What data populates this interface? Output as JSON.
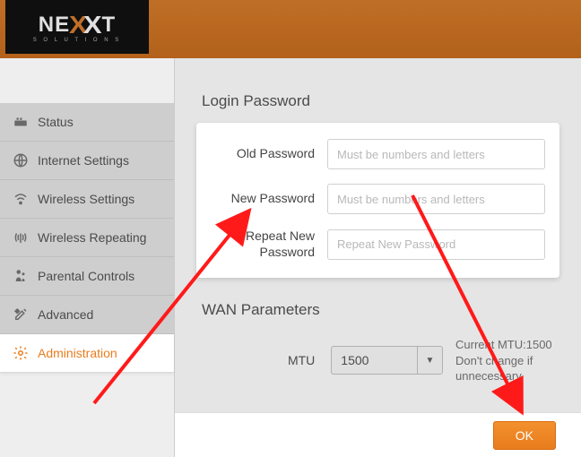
{
  "brand": {
    "name_a": "NE",
    "name_x1": "X",
    "name_x2": "X",
    "name_b": "T",
    "sub": "S O L U T I O N S"
  },
  "sidebar": {
    "items": [
      {
        "label": "Status"
      },
      {
        "label": "Internet Settings"
      },
      {
        "label": "Wireless Settings"
      },
      {
        "label": "Wireless Repeating"
      },
      {
        "label": "Parental Controls"
      },
      {
        "label": "Advanced"
      },
      {
        "label": "Administration"
      }
    ]
  },
  "main": {
    "login_title": "Login Password",
    "old_label": "Old Password",
    "old_placeholder": "Must be numbers and letters",
    "new_label": "New Password",
    "new_placeholder": "Must be numbers and letters",
    "repeat_label": "Repeat New Password",
    "repeat_placeholder": "Repeat New Password",
    "wan_title": "WAN Parameters",
    "mtu_label": "MTU",
    "mtu_value": "1500",
    "mtu_hint": "Current MTU:1500 Don't change if unnecessary"
  },
  "footer": {
    "ok": "OK"
  }
}
